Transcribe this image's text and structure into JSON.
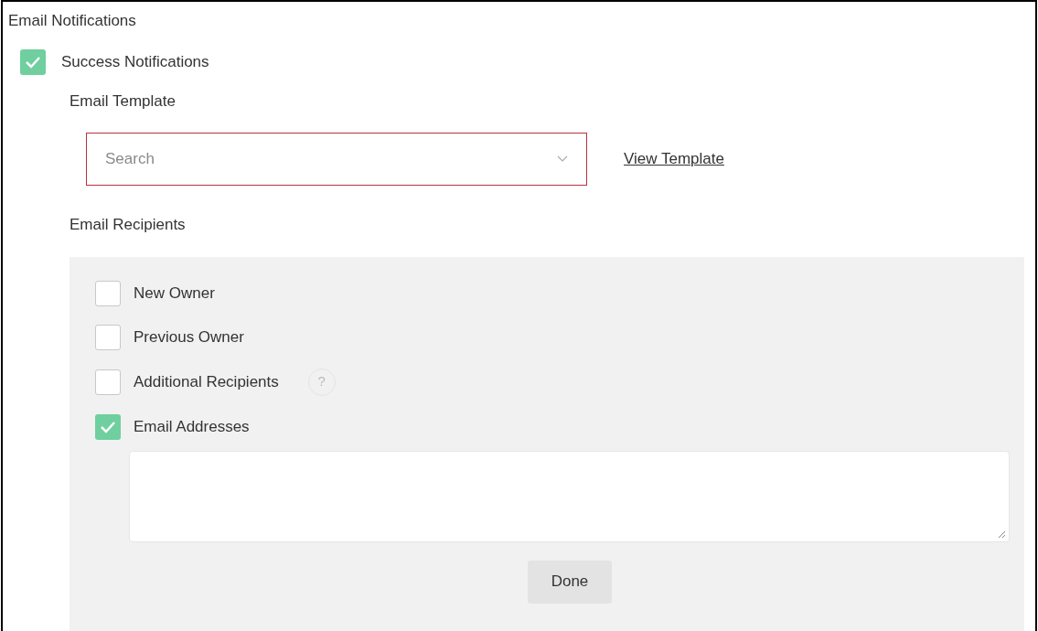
{
  "section_title": "Email Notifications",
  "success": {
    "label": "Success Notifications",
    "checked": true
  },
  "template": {
    "label": "Email Template",
    "placeholder": "Search",
    "invalid": true,
    "link": "View Template"
  },
  "recipients": {
    "label": "Email Recipients",
    "options": [
      {
        "label": "New Owner",
        "checked": false
      },
      {
        "label": "Previous Owner",
        "checked": false
      },
      {
        "label": "Additional Recipients",
        "checked": false,
        "help_text": "?"
      },
      {
        "label": "Email Addresses",
        "checked": true
      }
    ],
    "done": "Done"
  }
}
